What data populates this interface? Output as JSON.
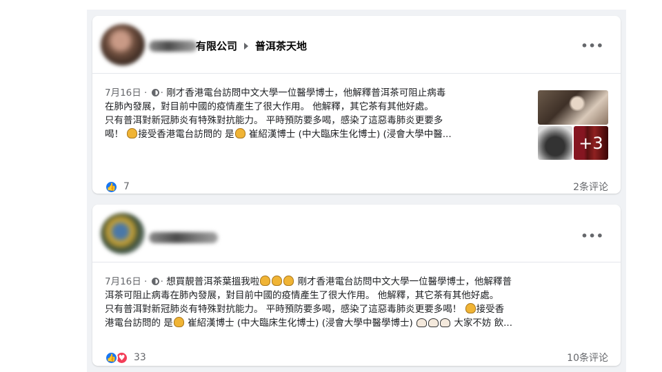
{
  "posts": [
    {
      "group_name": "有限公司",
      "group_page": "普洱茶天地",
      "date": "7月16日 ·",
      "privacy": "globe-icon",
      "lines": [
        "剛才香港電台訪問中文大學一位醫學博士，他解釋普洱茶可阻止病毒",
        "在肺內發展，對目前中國的疫情產生了很大作用。 他解釋，其它茶有其他好處。",
        "只有普洱對新冠肺炎有特殊對抗能力。 平時預防要多喝，感染了這惡毒肺炎更要多",
        "喝！"
      ],
      "line4_a": "接受香港電台訪問的 是",
      "line4_b": " 崔紹漢博士 (中大臨床生化博士) (浸會大學中醫...",
      "photos_more": "+3",
      "reaction_count": "7",
      "comments": "2条评论"
    },
    {
      "date": "7月16日 ·",
      "privacy": "globe-icon",
      "line1_a": "想買靚普洱茶葉搵我啦",
      "line1_b": " 剛才香港電台訪問中文大學一位醫學博士，他解釋普",
      "line2": "洱茶可阻止病毒在肺內發展，對目前中國的疫情產生了很大作用。 他解釋，其它茶有其他好處。",
      "line3": "只有普洱對新冠肺炎有特殊對抗能力。 平時預防要多喝，感染了這惡毒肺炎更要多喝！",
      "line3_b": "接受香",
      "line4_a": "港電台訪問的 是",
      "line4_b": " 崔紹漢博士 (中大臨床生化博士) (浸會大學中醫學博士)",
      "line4_c": " 大家不妨 飲...",
      "reaction_count": "33",
      "comments": "10条评论"
    }
  ],
  "icons": {
    "more": "•••",
    "like": "like-icon",
    "heart": "heart-icon",
    "point": "pointing-hand-icon"
  },
  "colors": {
    "like_blue": "#1877f2",
    "heart_red": "#f33e58",
    "meta_gray": "#65676b"
  }
}
